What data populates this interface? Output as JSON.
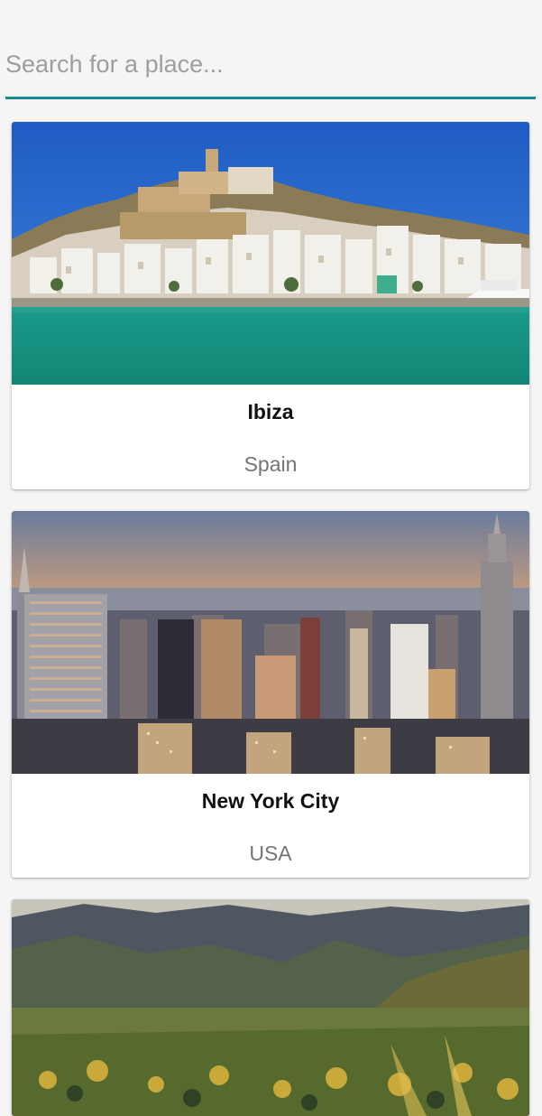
{
  "search": {
    "placeholder": "Search for a place...",
    "value": "",
    "accent_color": "#1b8a8f"
  },
  "places": [
    {
      "name": "Ibiza",
      "country": "Spain"
    },
    {
      "name": "New York City",
      "country": "USA"
    },
    {
      "name": "",
      "country": ""
    }
  ]
}
